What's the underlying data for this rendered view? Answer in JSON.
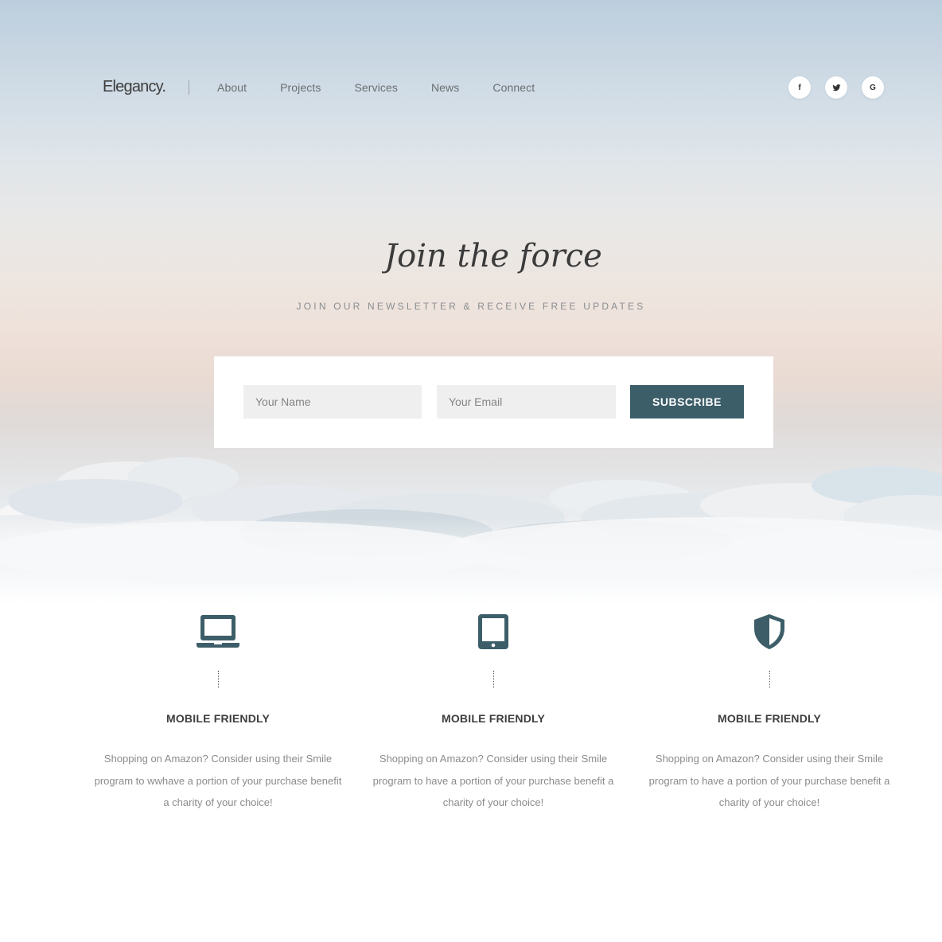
{
  "nav": {
    "logo": "Elegancy.",
    "links": [
      "About",
      "Projects",
      "Services",
      "News",
      "Connect"
    ],
    "socials": [
      {
        "label": "f",
        "icon": "facebook-icon"
      },
      {
        "label": "",
        "icon": "twitter-icon"
      },
      {
        "label": "G",
        "icon": "google-icon"
      }
    ]
  },
  "hero": {
    "script_title": "Join the force",
    "subtitle": "JOIN OUR NEWSLETTER & RECEIVE FREE UPDATES"
  },
  "form": {
    "name_placeholder": "Your Name",
    "email_placeholder": "Your Email",
    "subscribe_label": "SUBSCRIBE"
  },
  "features": [
    {
      "icon": "laptop-icon",
      "title": "MOBILE FRIENDLY",
      "text": "Shopping on Amazon? Consider using their Smile program to wwhave a portion of your purchase benefit a charity of your choice!"
    },
    {
      "icon": "tablet-icon",
      "title": "MOBILE FRIENDLY",
      "text": "Shopping on Amazon? Consider using their Smile program to have a portion of your purchase benefit a charity of your choice!"
    },
    {
      "icon": "shield-icon",
      "title": "MOBILE FRIENDLY",
      "text": "Shopping on Amazon? Consider using their Smile program to have a portion of your purchase benefit a charity of your choice!"
    }
  ],
  "colors": {
    "accent": "#3b5e69",
    "icon": "#3d5e68"
  }
}
